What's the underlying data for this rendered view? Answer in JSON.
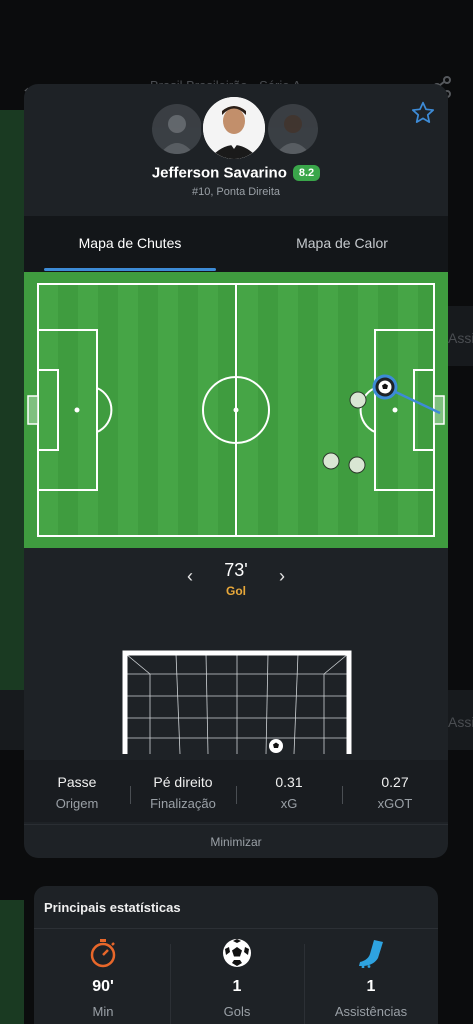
{
  "background": {
    "title": "Brasil Brasileirão - Série A",
    "side_text": "Assi"
  },
  "player": {
    "name": "Jefferson Savarino",
    "rating": "8.2",
    "subtitle": "#10, Ponta Direita"
  },
  "tabs": [
    {
      "label": "Mapa de Chutes",
      "active": true
    },
    {
      "label": "Mapa de Calor",
      "active": false
    }
  ],
  "shot": {
    "minute": "73'",
    "result": "Gol"
  },
  "shot_details": [
    {
      "value": "Passe",
      "label": "Origem"
    },
    {
      "value": "Pé direito",
      "label": "Finalização"
    },
    {
      "value": "0.31",
      "label": "xG"
    },
    {
      "value": "0.27",
      "label": "xGOT"
    }
  ],
  "minimize_label": "Minimizar",
  "main_stats": {
    "title": "Principais estatísticas",
    "items": [
      {
        "value": "90'",
        "label": "Min",
        "icon": "stopwatch-icon"
      },
      {
        "value": "1",
        "label": "Gols",
        "icon": "football-icon"
      },
      {
        "value": "1",
        "label": "Assistências",
        "icon": "boot-icon"
      }
    ]
  },
  "colors": {
    "pitch": "#3f9c3f",
    "accent_blue": "#3d8bd6",
    "rating_green": "#3aa64a",
    "goal_orange": "#e8a83a"
  }
}
